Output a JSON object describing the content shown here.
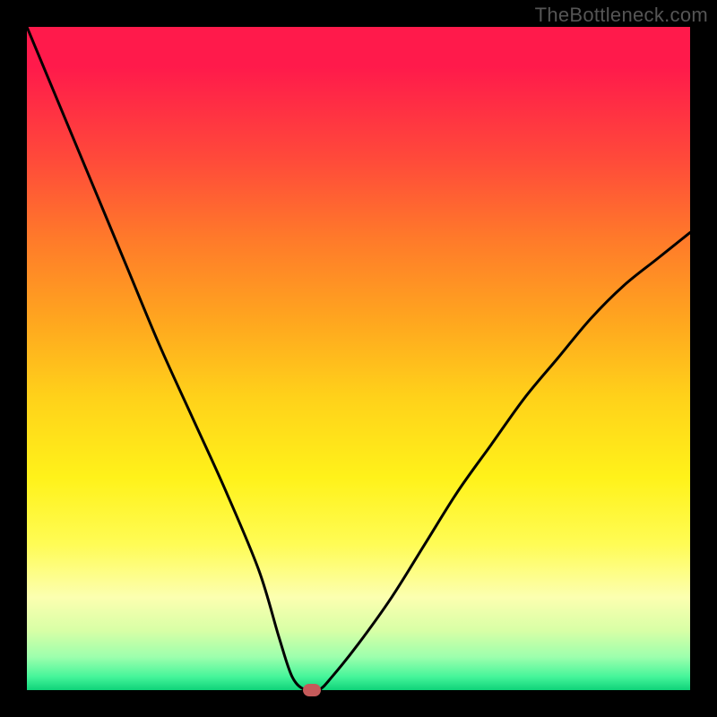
{
  "watermark": "TheBottleneck.com",
  "chart_data": {
    "type": "line",
    "title": "",
    "xlabel": "",
    "ylabel": "",
    "xlim": [
      0,
      100
    ],
    "ylim": [
      0,
      100
    ],
    "grid": false,
    "legend": false,
    "series": [
      {
        "name": "bottleneck-curve",
        "x": [
          0,
          5,
          10,
          15,
          20,
          25,
          30,
          35,
          38,
          40,
          42,
          44,
          46,
          50,
          55,
          60,
          65,
          70,
          75,
          80,
          85,
          90,
          95,
          100
        ],
        "y": [
          100,
          88,
          76,
          64,
          52,
          41,
          30,
          18,
          8,
          2,
          0,
          0,
          2,
          7,
          14,
          22,
          30,
          37,
          44,
          50,
          56,
          61,
          65,
          69
        ]
      }
    ],
    "marker": {
      "x": 43,
      "y": 0
    },
    "colors": {
      "background_top": "#ff1a4b",
      "background_mid": "#ffe81a",
      "background_bottom": "#0fd279",
      "curve": "#000000",
      "marker": "#c55a5a",
      "frame": "#000000"
    }
  }
}
